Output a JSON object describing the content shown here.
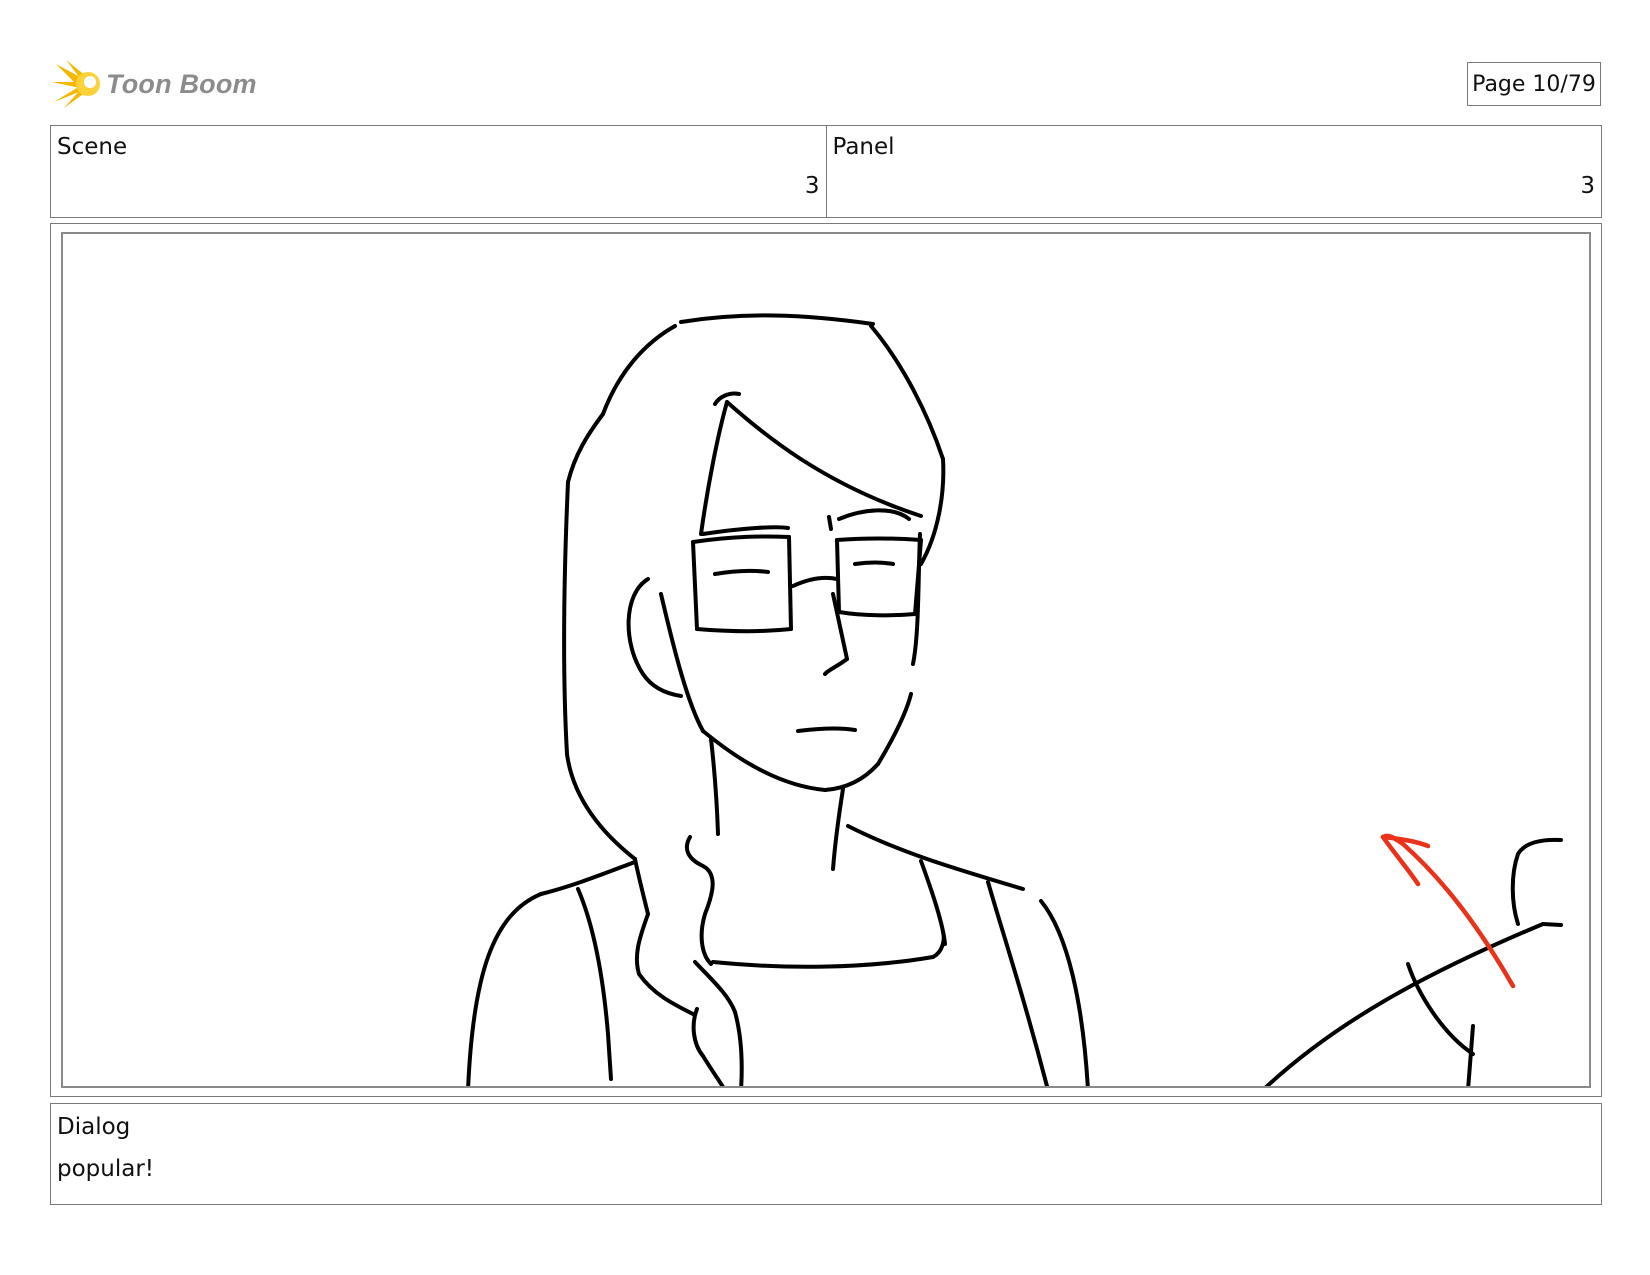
{
  "brand": {
    "name": "Toon Boom",
    "logo_icon": "starburst-icon",
    "accent": "#f5b800"
  },
  "page": {
    "label": "Page 10/79"
  },
  "header": {
    "scene_label": "Scene",
    "scene_value": "3",
    "panel_label": "Panel",
    "panel_value": "3"
  },
  "panel": {
    "description": "",
    "stroke_color": "#000000",
    "arrow_color": "#e8321a"
  },
  "dialog": {
    "label": "Dialog",
    "text": "popular!"
  }
}
